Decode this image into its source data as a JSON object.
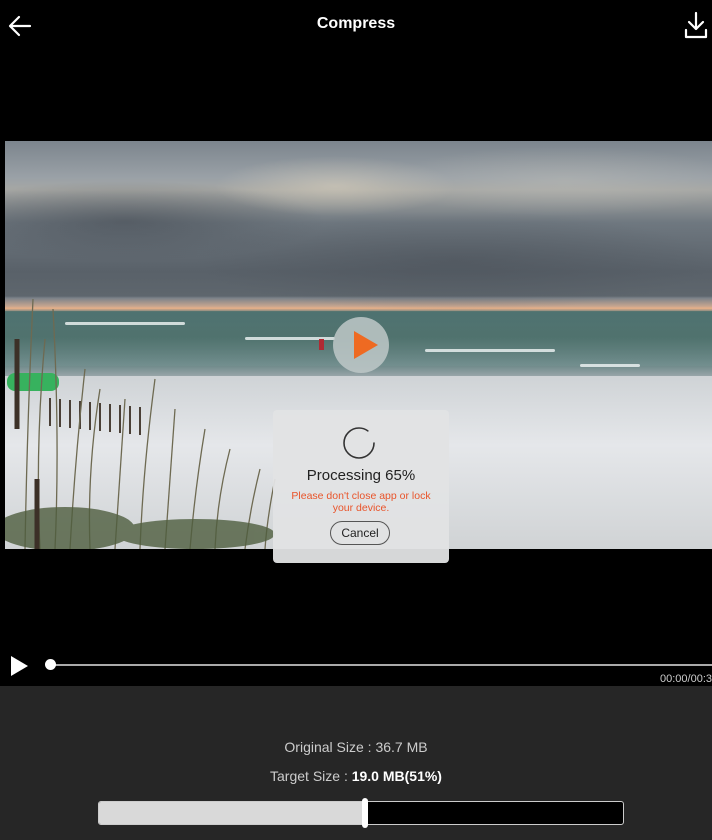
{
  "header": {
    "title": "Compress",
    "back_icon": "arrow-left-icon",
    "download_icon": "download-icon"
  },
  "video": {
    "center_play_icon": "play-icon",
    "accent_color": "#ee6a22"
  },
  "dialog": {
    "processing_text": "Processing 65%",
    "progress_percent": 65,
    "warning_text": "Please don't close app or lock your device.",
    "warning_color": "#e9542a",
    "cancel_label": "Cancel"
  },
  "player": {
    "play_icon": "play-icon",
    "time_text": "00:00/00:3",
    "position_fraction": 0
  },
  "sizes": {
    "original_label": "Original Size : ",
    "original_value": "36.7 MB",
    "target_label": "Target Size : ",
    "target_value": "19.0 MB(51%)",
    "target_fraction": 0.51
  }
}
